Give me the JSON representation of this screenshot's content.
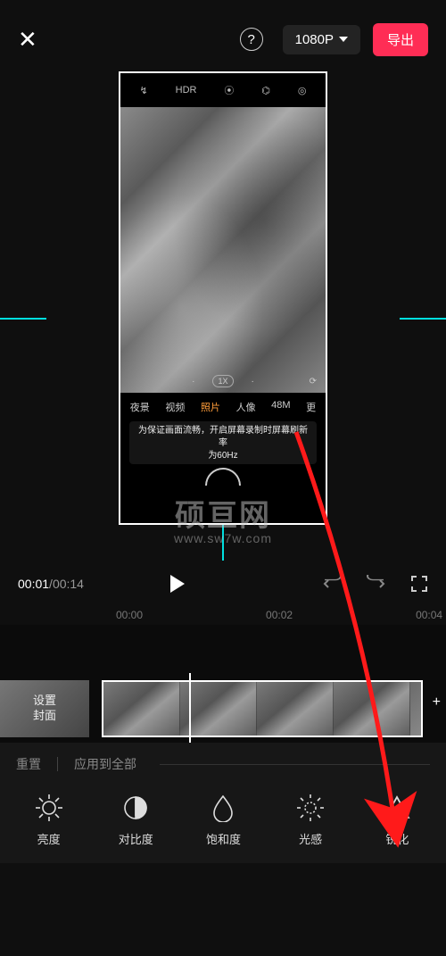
{
  "header": {
    "close": "✕",
    "help": "?",
    "resolution": "1080P",
    "export": "导出"
  },
  "preview": {
    "phone_top_icons": [
      "↯",
      "HDR",
      "⦿",
      "⌬",
      "◎"
    ],
    "zoom_label": "1X",
    "camera_flip": "⟳",
    "modes": {
      "night": "夜景",
      "video": "视频",
      "photo": "照片",
      "portrait": "人像",
      "m48": "48M",
      "more": "更"
    },
    "tip_line1": "为保证画面流畅，开启屏幕录制时屏幕刷新率",
    "tip_line2": "为60Hz"
  },
  "watermark": {
    "line1": "硕亘网",
    "line2": "www.sw7w.com"
  },
  "playbar": {
    "current": "00:01",
    "total": "00:14"
  },
  "ruler": {
    "t0": "00:00",
    "t2": "00:02",
    "t4": "00:04"
  },
  "timeline": {
    "cover_label_l1": "设置",
    "cover_label_l2": "封面",
    "plus": "+"
  },
  "adjust": {
    "reset": "重置",
    "apply_all": "应用到全部"
  },
  "tools": {
    "brightness": "亮度",
    "contrast": "对比度",
    "saturation": "饱和度",
    "light": "光感",
    "sharpen": "锐化"
  }
}
